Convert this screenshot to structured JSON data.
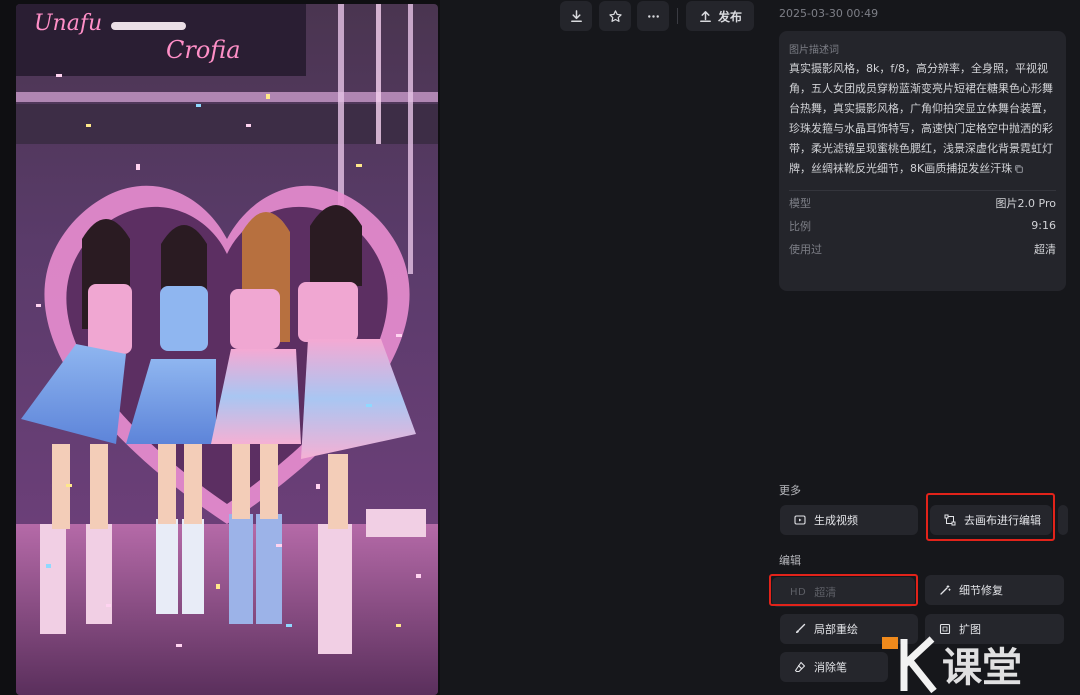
{
  "toolbar": {
    "publish_label": "发布",
    "download_icon": "download-icon",
    "favorite_icon": "star-icon",
    "more_icon": "more-icon",
    "publish_icon": "upload-icon"
  },
  "image": {
    "neon_sign_text": "Unafu Crofia"
  },
  "details": {
    "timestamp": "2025-03-30 00:49",
    "prompt_label": "图片描述词",
    "prompt_text": "真实摄影风格，8k，f/8，高分辨率，全身照，平视视角，五人女团成员穿粉蓝渐变亮片短裙在糖果色心形舞台热舞，真实摄影风格，广角仰拍突显立体舞台装置，珍珠发箍与水晶耳饰特写，高速快门定格空中抛洒的彩带，柔光滤镜呈现蜜桃色腮红，浅景深虚化背景霓虹灯牌，丝绸袜靴反光细节，8K画质捕捉发丝汗珠",
    "meta": [
      {
        "key": "模型",
        "value": "图片2.0 Pro"
      },
      {
        "key": "比例",
        "value": "9:16"
      },
      {
        "key": "使用过",
        "value": "超清"
      }
    ]
  },
  "more_section": {
    "heading": "更多",
    "generate_video": "生成视频",
    "canvas_edit": "去画布进行编辑"
  },
  "edit_section": {
    "heading": "编辑",
    "hd_tag": "HD",
    "hd_label": "超清",
    "detail_fix": "细节修复",
    "local_redraw": "局部重绘",
    "expand": "扩图",
    "eraser": "消除笔"
  },
  "watermark": {
    "text": "课堂"
  },
  "colors": {
    "background": "#16171b",
    "card": "#24252b",
    "highlight": "#e2231a",
    "watermark_orange": "#f08a1c"
  }
}
